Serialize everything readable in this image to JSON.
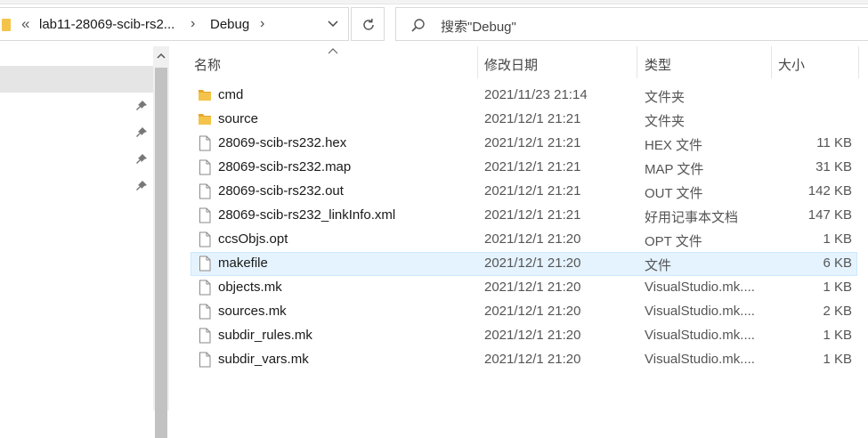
{
  "address": {
    "overflow": "«",
    "segment1": "lab11-28069-scib-rs2...",
    "segment2": "Debug"
  },
  "search": {
    "placeholder": "搜索\"Debug\""
  },
  "columns": {
    "name": "名称",
    "modified": "修改日期",
    "type": "类型",
    "size": "大小"
  },
  "files": [
    {
      "name": "cmd",
      "date": "2021/11/23 21:14",
      "type": "文件夹",
      "size": "",
      "icon": "folder-icon"
    },
    {
      "name": "source",
      "date": "2021/12/1 21:21",
      "type": "文件夹",
      "size": "",
      "icon": "folder-icon"
    },
    {
      "name": "28069-scib-rs232.hex",
      "date": "2021/12/1 21:21",
      "type": "HEX 文件",
      "size": "11 KB",
      "icon": "file-icon"
    },
    {
      "name": "28069-scib-rs232.map",
      "date": "2021/12/1 21:21",
      "type": "MAP 文件",
      "size": "31 KB",
      "icon": "file-icon"
    },
    {
      "name": "28069-scib-rs232.out",
      "date": "2021/12/1 21:21",
      "type": "OUT 文件",
      "size": "142 KB",
      "icon": "file-icon"
    },
    {
      "name": "28069-scib-rs232_linkInfo.xml",
      "date": "2021/12/1 21:21",
      "type": "好用记事本文档",
      "size": "147 KB",
      "icon": "file-icon"
    },
    {
      "name": "ccsObjs.opt",
      "date": "2021/12/1 21:20",
      "type": "OPT 文件",
      "size": "1 KB",
      "icon": "file-icon"
    },
    {
      "name": "makefile",
      "date": "2021/12/1 21:20",
      "type": "文件",
      "size": "6 KB",
      "icon": "file-icon"
    },
    {
      "name": "objects.mk",
      "date": "2021/12/1 21:20",
      "type": "VisualStudio.mk....",
      "size": "1 KB",
      "icon": "file-icon"
    },
    {
      "name": "sources.mk",
      "date": "2021/12/1 21:20",
      "type": "VisualStudio.mk....",
      "size": "2 KB",
      "icon": "file-icon"
    },
    {
      "name": "subdir_rules.mk",
      "date": "2021/12/1 21:20",
      "type": "VisualStudio.mk....",
      "size": "1 KB",
      "icon": "file-icon"
    },
    {
      "name": "subdir_vars.mk",
      "date": "2021/12/1 21:20",
      "type": "VisualStudio.mk....",
      "size": "1 KB",
      "icon": "file-icon"
    }
  ],
  "colors": {
    "selection": "#e5f3ff",
    "folder": "#f4c34a",
    "nav_selected": "#e5e5e5"
  }
}
